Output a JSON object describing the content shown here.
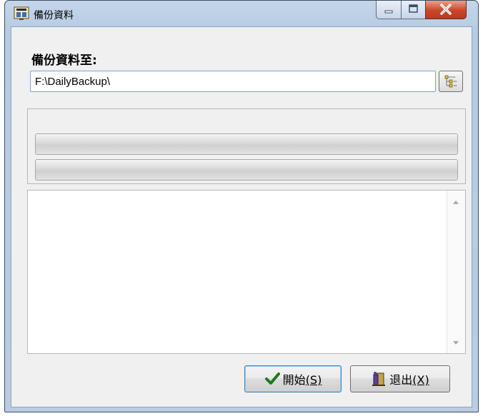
{
  "window": {
    "title": "備份資料"
  },
  "form": {
    "target_label": "備份資料至:",
    "target_path": "F:\\DailyBackup\\",
    "browse_icon": "folder-tree-icon"
  },
  "progress": {
    "overall_fraction": 0,
    "file_fraction": 0
  },
  "log": {
    "text": ""
  },
  "buttons": {
    "start_label": "開始",
    "start_mnemonic": "(S)",
    "start_icon": "checkmark-icon",
    "exit_label": "退出",
    "exit_mnemonic": "(X)",
    "exit_icon": "exit-door-icon"
  },
  "colors": {
    "checkmark": "#1c7a1c",
    "close_button": "#c9462a"
  }
}
